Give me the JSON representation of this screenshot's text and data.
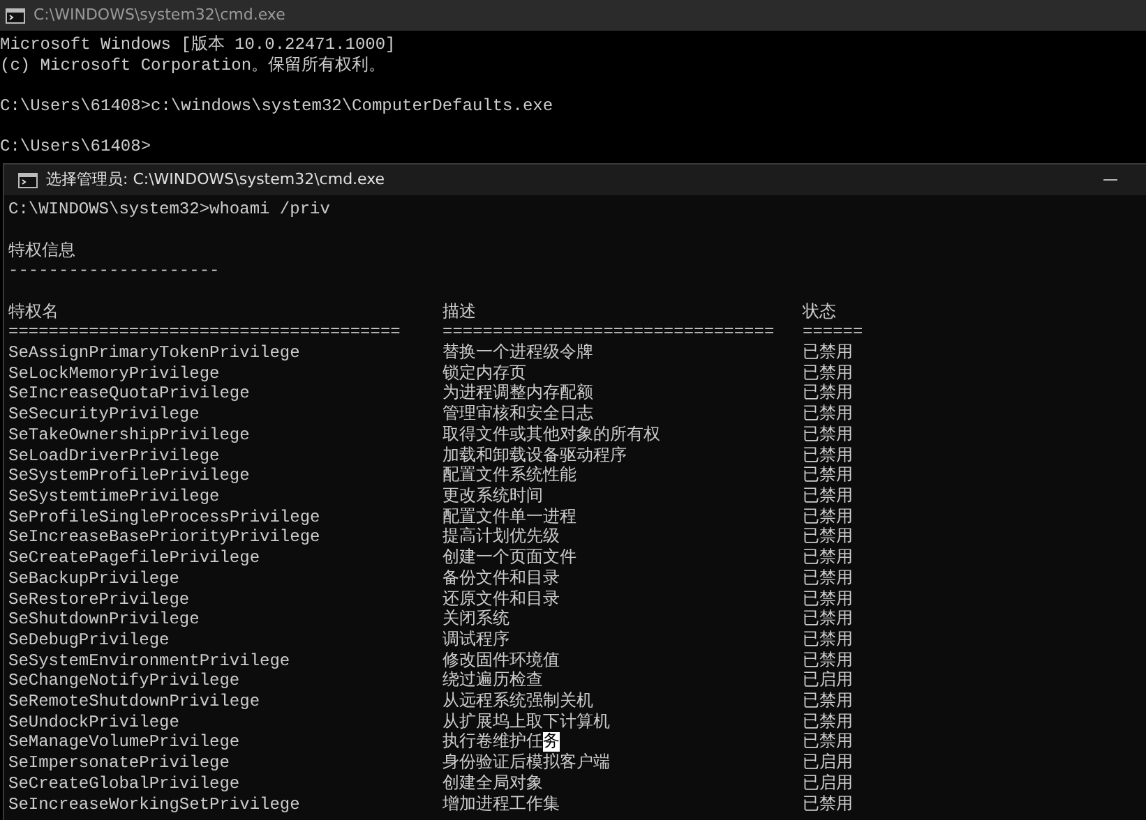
{
  "back_window": {
    "title": "C:\\WINDOWS\\system32\\cmd.exe",
    "blocks": [
      [
        "Microsoft Windows [版本 10.0.22471.1000]",
        "(c) Microsoft Corporation。保留所有权利。"
      ],
      [
        "C:\\Users\\61408>c:\\windows\\system32\\ComputerDefaults.exe"
      ],
      [
        "C:\\Users\\61408>"
      ]
    ]
  },
  "front_window": {
    "title": "选择管理员: C:\\WINDOWS\\system32\\cmd.exe",
    "minimize": "—",
    "command": "C:\\WINDOWS\\system32>whoami /priv",
    "section_title": "特权信息",
    "section_rule": "---------------------",
    "columns": [
      {
        "label": "特权名",
        "rule": "======================================="
      },
      {
        "label": "描述",
        "rule": "================================="
      },
      {
        "label": "状态",
        "rule": "======"
      }
    ],
    "rows": [
      {
        "name": "SeAssignPrimaryTokenPrivilege",
        "desc": "替换一个进程级令牌",
        "status": "已禁用"
      },
      {
        "name": "SeLockMemoryPrivilege",
        "desc": "锁定内存页",
        "status": "已禁用"
      },
      {
        "name": "SeIncreaseQuotaPrivilege",
        "desc": "为进程调整内存配额",
        "status": "已禁用"
      },
      {
        "name": "SeSecurityPrivilege",
        "desc": "管理审核和安全日志",
        "status": "已禁用"
      },
      {
        "name": "SeTakeOwnershipPrivilege",
        "desc": "取得文件或其他对象的所有权",
        "status": "已禁用"
      },
      {
        "name": "SeLoadDriverPrivilege",
        "desc": "加载和卸载设备驱动程序",
        "status": "已禁用"
      },
      {
        "name": "SeSystemProfilePrivilege",
        "desc": "配置文件系统性能",
        "status": "已禁用"
      },
      {
        "name": "SeSystemtimePrivilege",
        "desc": "更改系统时间",
        "status": "已禁用"
      },
      {
        "name": "SeProfileSingleProcessPrivilege",
        "desc": "配置文件单一进程",
        "status": "已禁用"
      },
      {
        "name": "SeIncreaseBasePriorityPrivilege",
        "desc": "提高计划优先级",
        "status": "已禁用"
      },
      {
        "name": "SeCreatePagefilePrivilege",
        "desc": "创建一个页面文件",
        "status": "已禁用"
      },
      {
        "name": "SeBackupPrivilege",
        "desc": "备份文件和目录",
        "status": "已禁用"
      },
      {
        "name": "SeRestorePrivilege",
        "desc": "还原文件和目录",
        "status": "已禁用"
      },
      {
        "name": "SeShutdownPrivilege",
        "desc": "关闭系统",
        "status": "已禁用"
      },
      {
        "name": "SeDebugPrivilege",
        "desc": "调试程序",
        "status": "已禁用"
      },
      {
        "name": "SeSystemEnvironmentPrivilege",
        "desc": "修改固件环境值",
        "status": "已禁用"
      },
      {
        "name": "SeChangeNotifyPrivilege",
        "desc": "绕过遍历检查",
        "status": "已启用"
      },
      {
        "name": "SeRemoteShutdownPrivilege",
        "desc": "从远程系统强制关机",
        "status": "已禁用"
      },
      {
        "name": "SeUndockPrivilege",
        "desc": "从扩展坞上取下计算机",
        "status": "已禁用"
      },
      {
        "name": "SeManageVolumePrivilege",
        "desc": "执行卷维护任",
        "desc_selected": "务",
        "status": "已禁用"
      },
      {
        "name": "SeImpersonatePrivilege",
        "desc": "身份验证后模拟客户端",
        "status": "已启用"
      },
      {
        "name": "SeCreateGlobalPrivilege",
        "desc": "创建全局对象",
        "status": "已启用"
      },
      {
        "name": "SeIncreaseWorkingSetPrivilege",
        "desc": "增加进程工作集",
        "status": "已禁用"
      }
    ]
  }
}
